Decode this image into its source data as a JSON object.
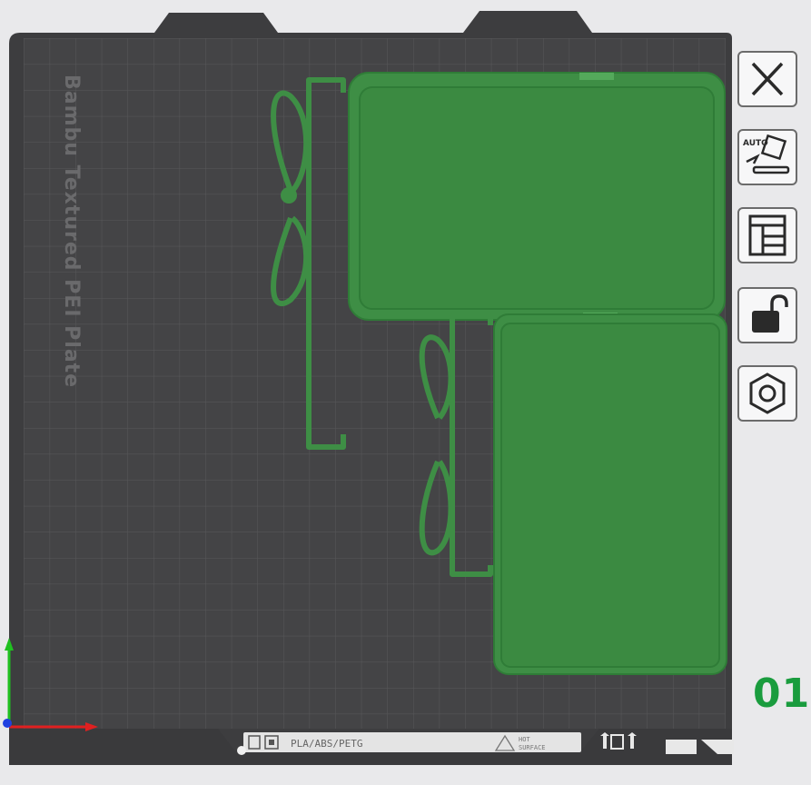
{
  "plate": {
    "name": "Bambu Textured PEI Plate",
    "number": "01",
    "label_filament": "PLA/ABS/PETG",
    "label_hot_line1": "HOT",
    "label_hot_line2": "SURFACE"
  },
  "toolbar": {
    "close_icon": "close-icon",
    "auto_orient_icon": "auto-orient-icon",
    "auto_orient_text": "AUTO",
    "arrange_icon": "arrange-icon",
    "lock_icon": "lock-icon",
    "settings_icon": "hexagon-nut-icon"
  },
  "colors": {
    "plate": "#3f3f41",
    "grid": "#5a5a5c",
    "model": "#3e8e45",
    "model_edge": "#2f7c37",
    "background": "#e9e9eb",
    "accent": "#1a9c3e"
  }
}
